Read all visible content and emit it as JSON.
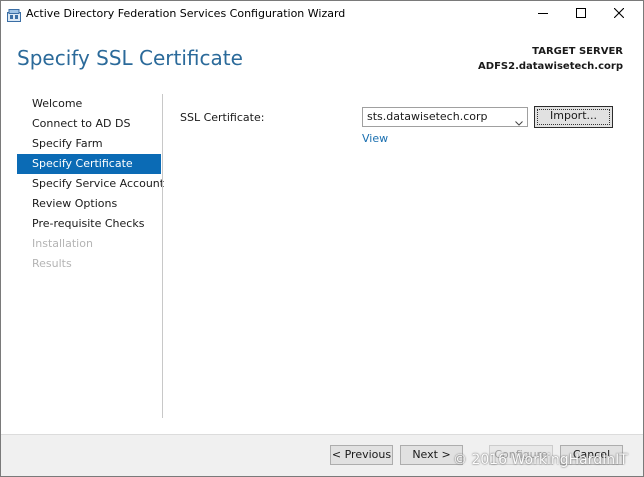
{
  "window": {
    "title": "Active Directory Federation Services Configuration Wizard"
  },
  "header": {
    "page_title": "Specify SSL Certificate",
    "target_label": "TARGET SERVER",
    "target_server": "ADFS2.datawisetech.corp"
  },
  "sidebar": {
    "items": [
      {
        "label": "Welcome",
        "state": "normal"
      },
      {
        "label": "Connect to AD DS",
        "state": "normal"
      },
      {
        "label": "Specify Farm",
        "state": "normal"
      },
      {
        "label": "Specify Certificate",
        "state": "active"
      },
      {
        "label": "Specify Service Account",
        "state": "normal"
      },
      {
        "label": "Review Options",
        "state": "normal"
      },
      {
        "label": "Pre-requisite Checks",
        "state": "normal"
      },
      {
        "label": "Installation",
        "state": "disabled"
      },
      {
        "label": "Results",
        "state": "disabled"
      }
    ]
  },
  "main": {
    "ssl_label": "SSL Certificate:",
    "certificate_value": "sts.datawisetech.corp",
    "import_label": "Import...",
    "view_label": "View"
  },
  "footer": {
    "previous_label": "< Previous",
    "next_label": "Next >",
    "configure_label": "Configure",
    "cancel_label": "Cancel"
  },
  "watermark": "© 2016 WorkingHardInIT",
  "colors": {
    "accent": "#0b6bb5",
    "title": "#2b6a9a",
    "link": "#1a6fb0"
  }
}
